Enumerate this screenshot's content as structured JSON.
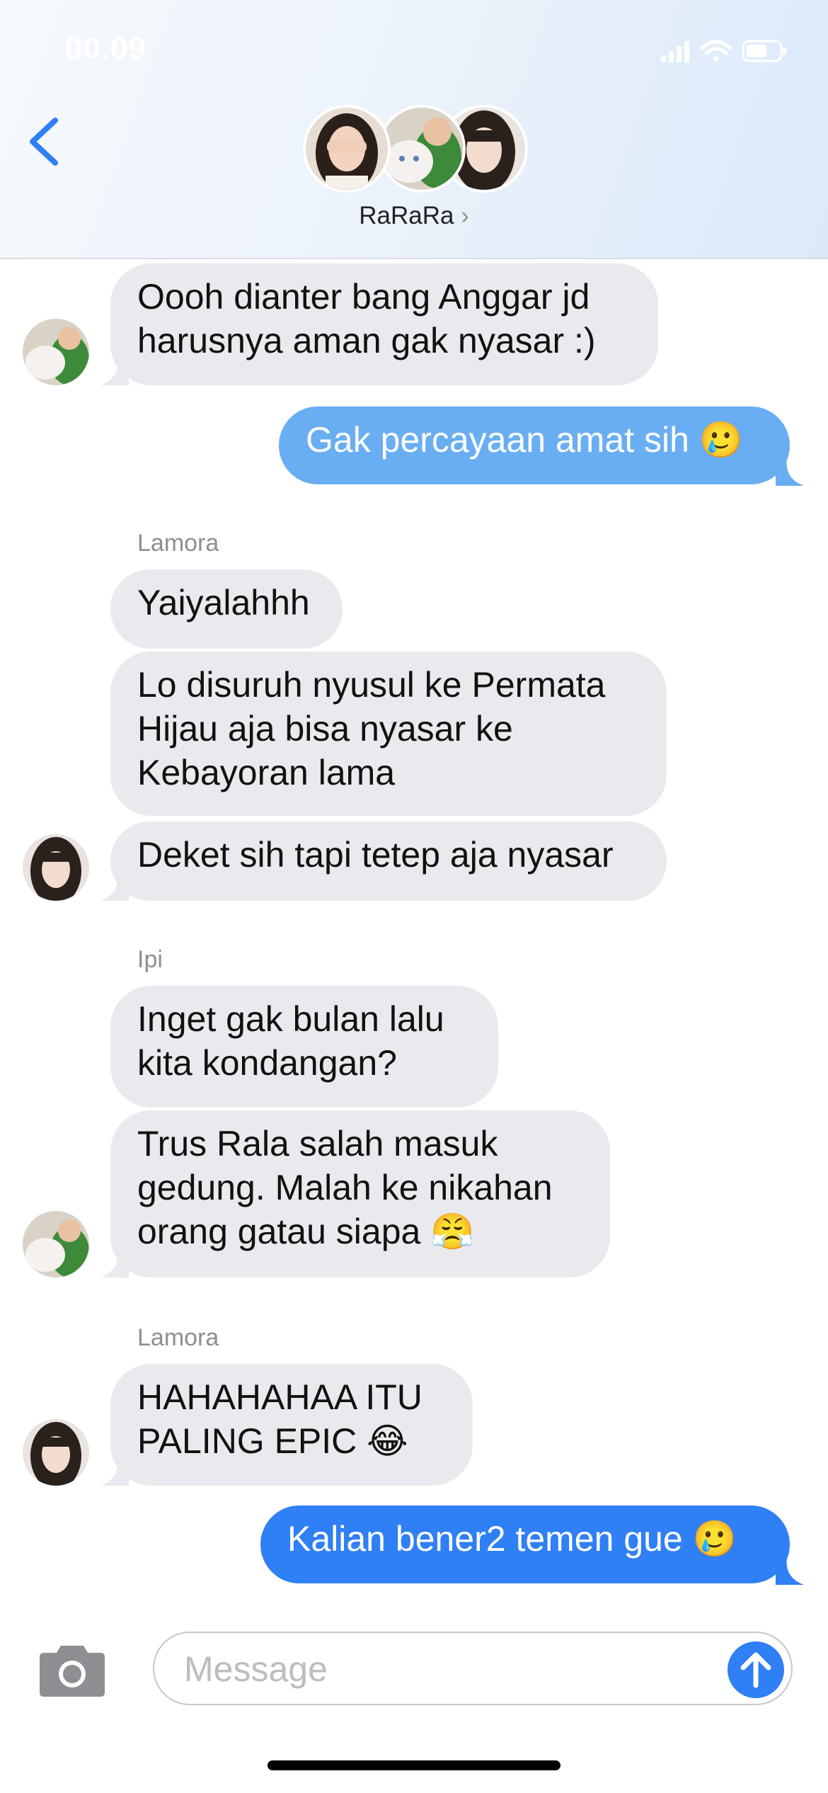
{
  "status_bar": {
    "time": "00.09"
  },
  "header": {
    "group_name": "RaRaRa",
    "chevron": "›"
  },
  "messages": {
    "m1": "Oooh dianter bang Anggar jd\nharusnya aman gak nyasar :)",
    "m2": "Gak percayaan amat sih 🥲",
    "sender1": "Lamora",
    "m3": "Yaiyalahhh",
    "m4": "Lo disuruh nyusul ke Permata\nHijau aja bisa nyasar ke\nKebayoran lama",
    "m5": "Deket sih tapi tetep aja nyasar",
    "sender2": "Ipi",
    "m6": "Inget gak bulan lalu\nkita kondangan?",
    "m7": "Trus Rala salah masuk\ngedung. Malah ke nikahan\norang gatau siapa 😤",
    "sender3": "Lamora",
    "m8": "HAHAHAHAA ITU\nPALING EPIC 😂",
    "m9": "Kalian bener2 temen gue 🥲"
  },
  "composer": {
    "placeholder": "Message"
  },
  "colors": {
    "accent": "#2f7ff5",
    "incoming_bubble": "#e9e9ee",
    "outgoing_faded": "#69aef3"
  },
  "icons": {
    "back": "chevron-left-icon",
    "camera": "camera-icon",
    "send": "arrow-up-icon",
    "signal": "signal-icon",
    "wifi": "wifi-icon",
    "battery": "battery-icon"
  }
}
